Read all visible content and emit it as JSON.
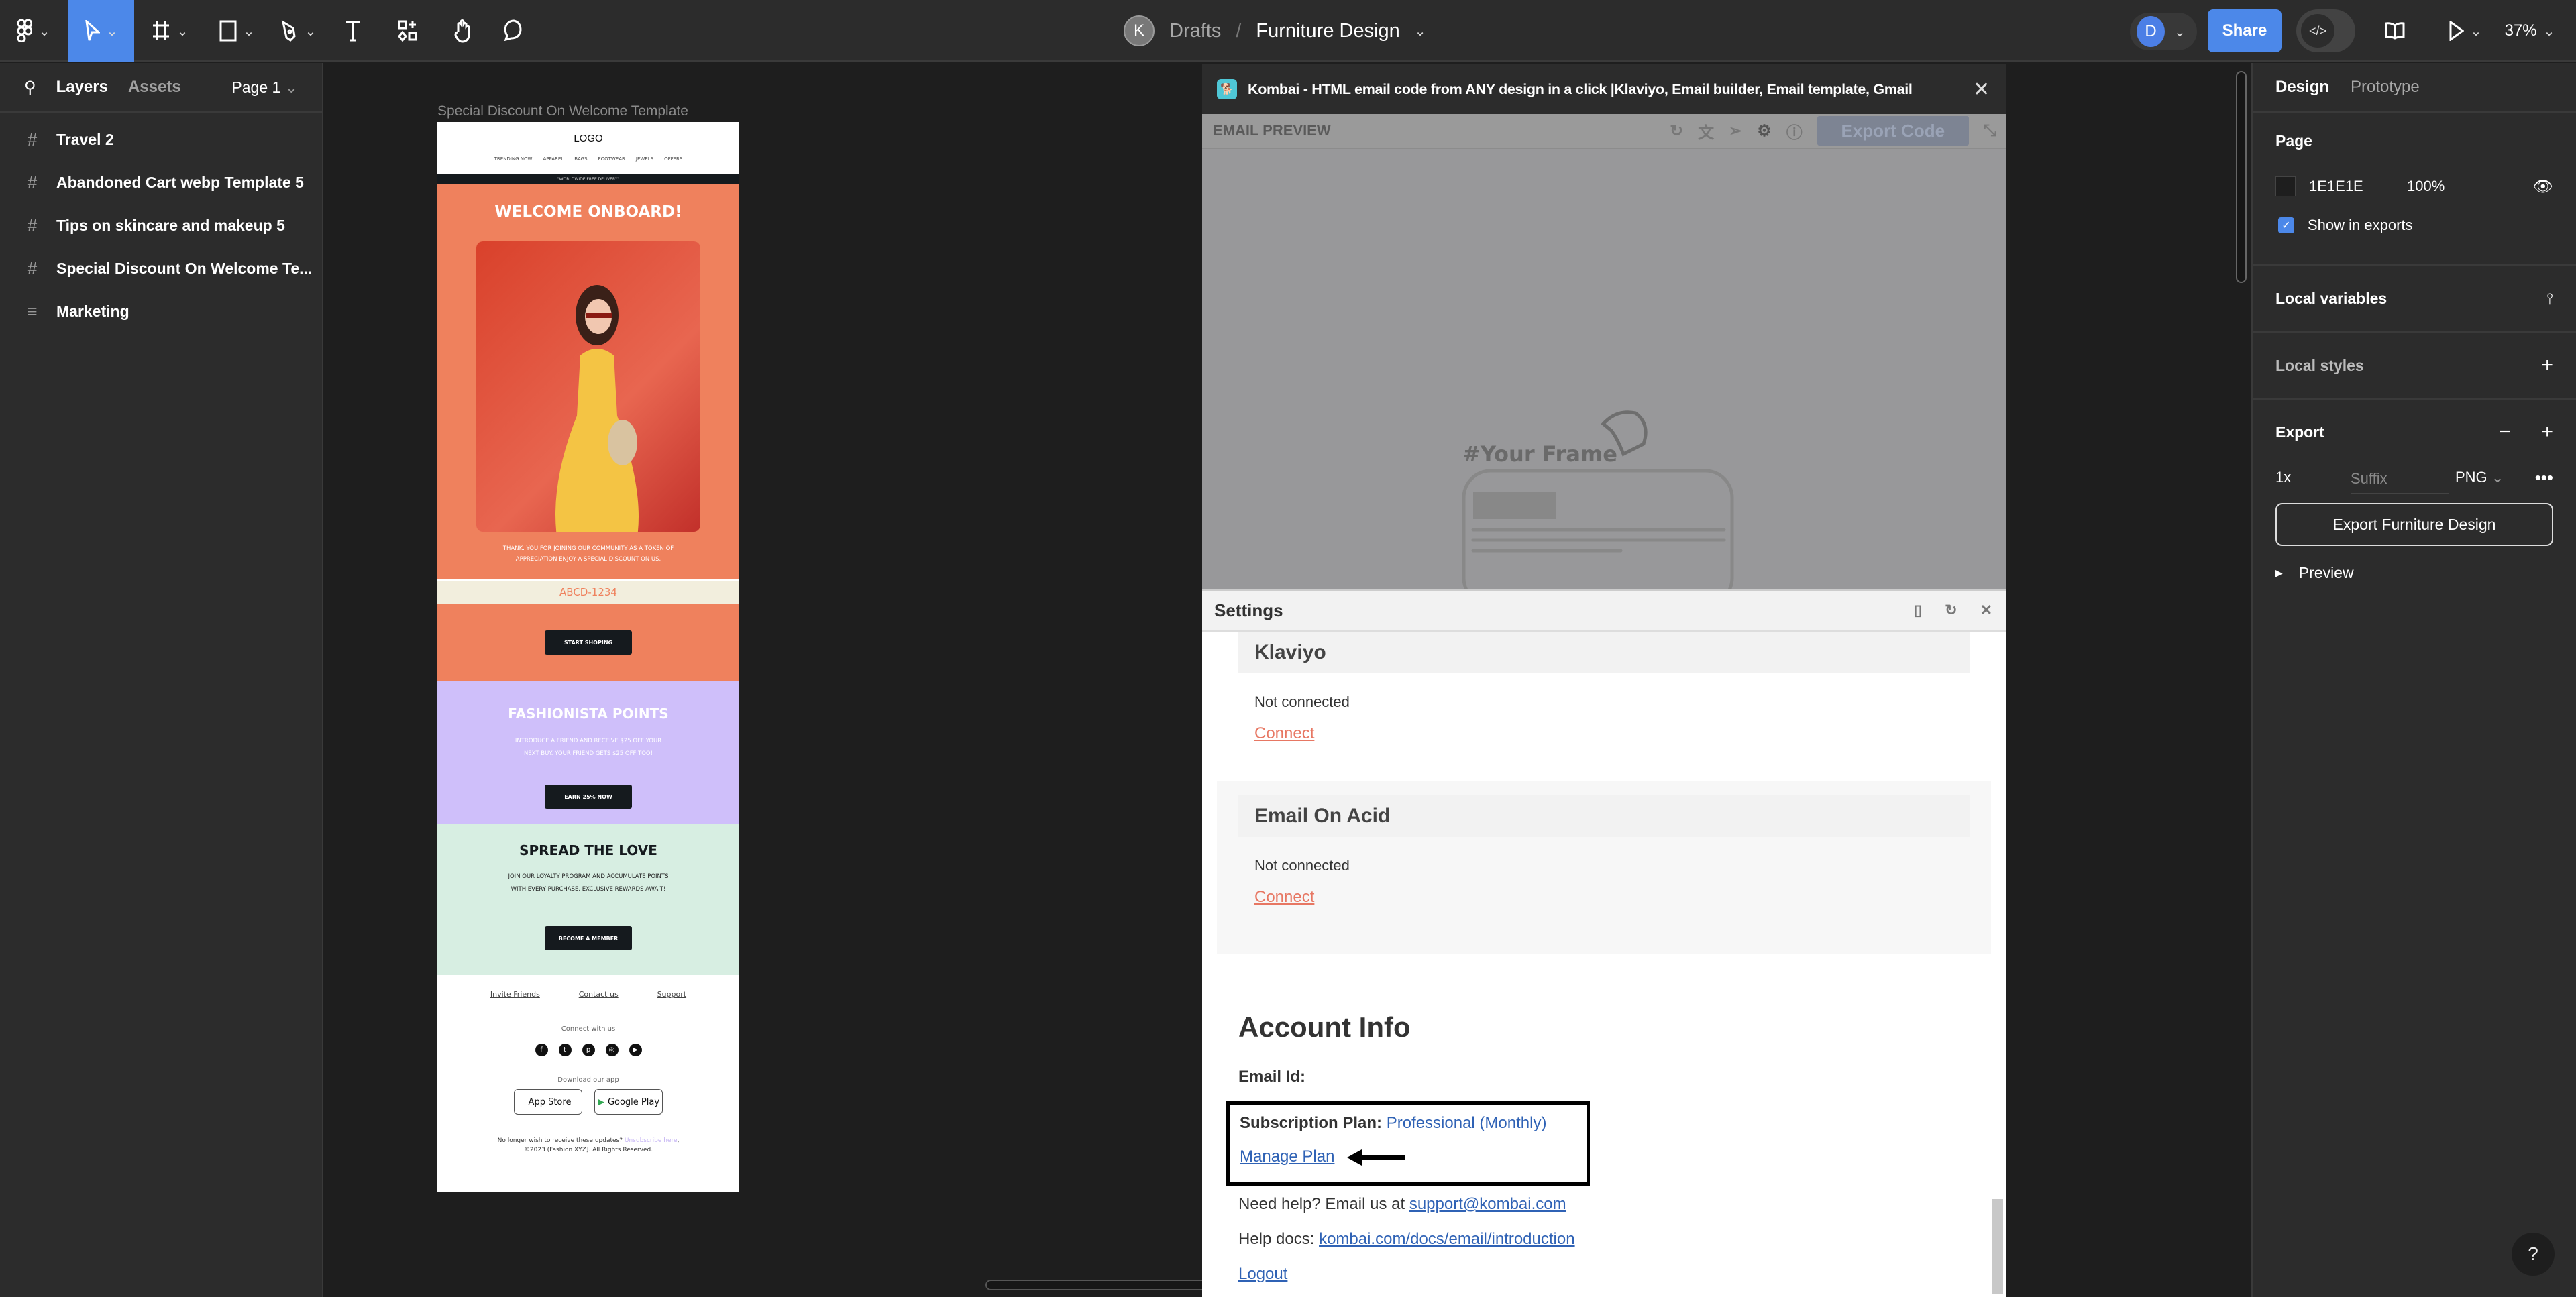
{
  "topbar": {
    "tools": [
      "main-menu",
      "move",
      "frame",
      "shape",
      "pen",
      "text",
      "resources",
      "hand",
      "comment"
    ],
    "team_initial": "K",
    "breadcrumb_parent": "Drafts",
    "breadcrumb_sep": "/",
    "file_name": "Furniture Design",
    "user_initial": "D",
    "share_label": "Share",
    "dev_mode_label": "</>",
    "zoom_level": "37%"
  },
  "left_panel": {
    "tabs": [
      "Layers",
      "Assets"
    ],
    "page_selector": "Page 1",
    "layers": [
      {
        "icon": "#",
        "name": "Travel 2"
      },
      {
        "icon": "#",
        "name": "Abandoned Cart webp Template 5"
      },
      {
        "icon": "#",
        "name": "Tips on skincare and makeup 5"
      },
      {
        "icon": "#",
        "name": "Special Discount On Welcome Te..."
      },
      {
        "icon": "≡",
        "name": "Marketing"
      }
    ]
  },
  "canvas": {
    "frame_label": "Special Discount On Welcome Template",
    "email": {
      "logo": "LOGO",
      "nav": [
        "TRENDING NOW",
        "APPAREL",
        "BAGS",
        "FOOTWEAR",
        "JEWELS",
        "OFFERS"
      ],
      "delivery": "\"WORLDWIDE FREE DELIVERY\"",
      "welcome_title": "WELCOME ONBOARD!",
      "thanks_line1": "THANK. YOU FOR JOINING OUR COMMUNITY AS A TOKEN OF",
      "thanks_line2": "APPRECIATION ENJOY A SPECIAL DISCOUNT ON US.",
      "code": "ABCD-1234",
      "cta1": "START SHOPING",
      "points_title": "FASHIONISTA POINTS",
      "points_line1": "INTRODUCE A FRIEND AND RECEIVE $25 OFF YOUR",
      "points_line2": "NEXT BUY. YOUR FRIEND GETS $25 OFF TOO!",
      "cta2": "EARN 25% NOW",
      "love_title": "SPREAD THE LOVE",
      "love_line1": "JOIN OUR LOYALTY PROGRAM AND ACCUMULATE POINTS",
      "love_line2": "WITH EVERY PURCHASE. EXCLUSIVE REWARDS AWAIT!",
      "cta3": "BECOME A MEMBER",
      "footer_links": [
        "Invite Friends",
        "Contact us",
        "Support"
      ],
      "connect": "Connect with us",
      "social": [
        "f",
        "t",
        "p",
        "◎",
        "▶"
      ],
      "download": "Download our app",
      "stores": [
        "App Store",
        "Google Play"
      ],
      "legal_prefix": "No longer wish to receive these updates?",
      "unsubscribe": "Unsubscribe here",
      "copyright": "©2023 (Fashion XYZ]. All Rights Reserved."
    }
  },
  "kombai": {
    "title": "Kombai - HTML email code from ANY design in a click |Klaviyo, Email builder, Email template, Gmail",
    "preview_label": "EMAIL PREVIEW",
    "export_label": "Export Code",
    "placeholder_frame": "#Your Frame",
    "settings": {
      "title": "Settings",
      "integrations": [
        {
          "name": "Klaviyo",
          "status": "Not connected",
          "action": "Connect"
        },
        {
          "name": "Email On Acid",
          "status": "Not connected",
          "action": "Connect"
        }
      ],
      "account": {
        "heading": "Account Info",
        "email_label": "Email Id:",
        "plan_label": "Subscription Plan:",
        "plan_value": "Professional (Monthly)",
        "manage_plan": "Manage Plan",
        "help_prefix": "Need help? Email us at",
        "help_email": "support@kombai.com",
        "docs_prefix": "Help docs:",
        "docs_link": "kombai.com/docs/email/introduction",
        "logout": "Logout"
      }
    }
  },
  "right_panel": {
    "tabs": [
      "Design",
      "Prototype"
    ],
    "page_section": "Page",
    "page_color": "1E1E1E",
    "page_opacity": "100%",
    "show_in_exports": "Show in exports",
    "show_in_exports_checked": true,
    "local_variables": "Local variables",
    "local_styles": "Local styles",
    "export_section": "Export",
    "export_scale": "1x",
    "export_suffix_placeholder": "Suffix",
    "export_format": "PNG",
    "export_button": "Export Furniture Design",
    "preview": "Preview"
  },
  "help_label": "?"
}
